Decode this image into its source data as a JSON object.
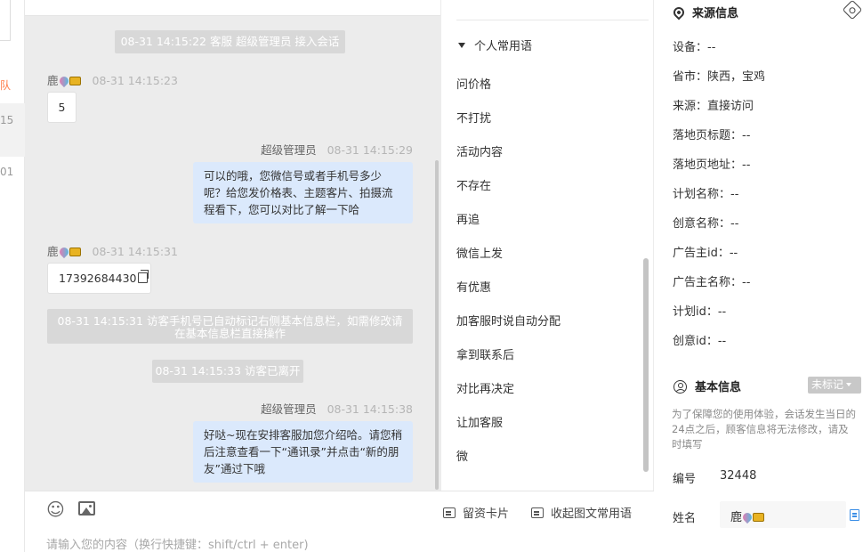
{
  "sidebar": {
    "team_label": "队",
    "num1": "15",
    "num2": "01"
  },
  "chat": {
    "system_messages": [
      "08-31 14:15:22 客服 超级管理员 接入会话",
      "08-31 14:15:31 访客手机号已自动标记右侧基本信息栏，如需修改请在基本信息栏直接操作",
      "08-31 14:15:33 访客已离开"
    ],
    "visitor_name": "鹿",
    "agent_name": "超级管理员",
    "messages": [
      {
        "time": "08-31 14:15:23",
        "text": "5"
      },
      {
        "time": "08-31 14:15:29",
        "text": "可以的哦，您微信号或者手机号多少呢？给您发价格表、主题客片、拍摄流程看下，您可以对比了解一下哈"
      },
      {
        "time": "08-31 14:15:31",
        "text": "17392684430"
      },
      {
        "time": "08-31 14:15:38",
        "text": "好哒~现在安排客服加您介绍哈。请您稍后注意查看一下“通讯录”并点击“新的朋友”通过下哦"
      }
    ]
  },
  "input": {
    "placeholder": "请输入您的内容（换行快捷键：shift/ctrl + enter)",
    "card_button": "留资卡片",
    "collapse_button": "收起图文常用语",
    "icons": {
      "emoji": "emoji-icon",
      "image": "image-icon"
    }
  },
  "phrases": {
    "group_title": "个人常用语",
    "items": [
      "问价格",
      "不打扰",
      "活动内容",
      "不存在",
      "再追",
      "微信上发",
      "有优惠",
      "加客服时说自动分配",
      "拿到联系后",
      "对比再决定",
      "让加客服",
      "微"
    ]
  },
  "source_info": {
    "title": "来源信息",
    "rows": [
      "设备：--",
      "省市：陕西，宝鸡",
      "来源：直接访问",
      "落地页标题：--",
      "落地页地址：--",
      "计划名称：--",
      "创意名称：--",
      "广告主id：--",
      "广告主名称：--",
      "计划id：--",
      "创意id：--"
    ]
  },
  "basic_info": {
    "title": "基本信息",
    "tag_button": "未标记",
    "notice": "为了保障您的使用体验，会话发生当日的24点之后，顾客信息将无法修改，请及时填写",
    "id_label": "编号",
    "id_value": "32448",
    "name_label": "姓名",
    "name_value": "鹿"
  }
}
